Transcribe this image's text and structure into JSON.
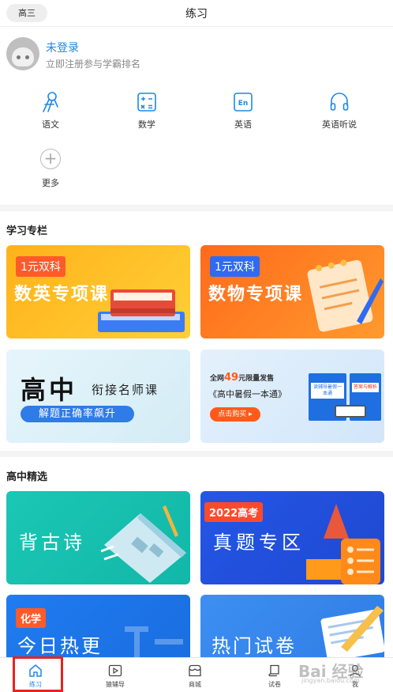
{
  "header": {
    "grade": "高三",
    "title": "练习"
  },
  "user": {
    "name": "未登录",
    "subtitle": "立即注册参与学霸排名"
  },
  "subjects": [
    {
      "label": "语文",
      "icon": "chinese-icon"
    },
    {
      "label": "数学",
      "icon": "math-icon"
    },
    {
      "label": "英语",
      "icon": "english-icon"
    },
    {
      "label": "英语听说",
      "icon": "headphones-icon"
    },
    {
      "label": "更多",
      "icon": "plus-icon",
      "symbol": "+"
    }
  ],
  "column": {
    "title": "学习专栏",
    "cards": [
      {
        "tag": "1元双科",
        "title": "数英专项课"
      },
      {
        "tag": "1元双科",
        "title": "数物专项课"
      },
      {
        "title_big": "高中",
        "title_small": "衔接名师课",
        "banner": "解题正确率飙升"
      },
      {
        "line_prefix": "全网",
        "price": "49",
        "line_suffix": "元限量发售",
        "book": "《高中暑假一本通》",
        "button": "点击购买 ▸",
        "book_label1": "读辅导暑假一本通",
        "book_label2": "答案与解析"
      }
    ]
  },
  "featured": {
    "title": "高中精选",
    "cards": [
      {
        "title": "背古诗"
      },
      {
        "tag": "2022高考",
        "title": "真题专区"
      },
      {
        "tag": "化学",
        "title": "今日热更"
      },
      {
        "title": "热门试卷"
      }
    ]
  },
  "tabbar": {
    "items": [
      {
        "label": "练习",
        "icon": "home-icon"
      },
      {
        "label": "猿辅导",
        "icon": "play-icon"
      },
      {
        "label": "商城",
        "icon": "store-icon"
      },
      {
        "label": "试卷",
        "icon": "paper-icon"
      },
      {
        "label": "我",
        "icon": "profile-icon"
      }
    ]
  },
  "watermark": {
    "text": "Bai 经验",
    "sub": "jingyan.baidu.com"
  },
  "colors": {
    "accent": "#1e88e5",
    "highlight": "#e8231f"
  }
}
